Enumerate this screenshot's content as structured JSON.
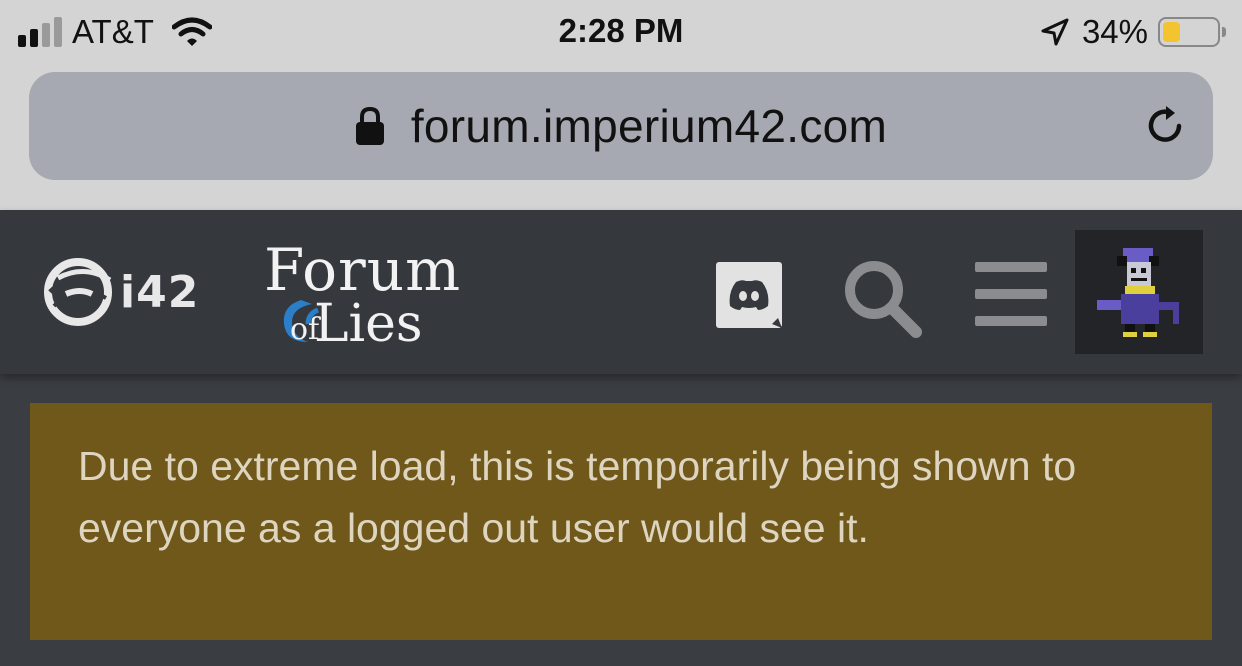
{
  "status_bar": {
    "carrier": "AT&T",
    "time": "2:28 PM",
    "battery_percent": "34%",
    "battery_level": 0.34,
    "signal_bars_active": 2,
    "signal_bars_total": 4,
    "icons": [
      "signal-bars-icon",
      "wifi-icon",
      "location-arrow-icon",
      "battery-icon"
    ]
  },
  "browser": {
    "url": "forum.imperium42.com",
    "icons": [
      "lock-icon",
      "reload-icon"
    ]
  },
  "site_header": {
    "brand_logo_text": "i42",
    "forum_logo": {
      "line1": "Forum",
      "of": "of",
      "line2": "Lies"
    },
    "icons": [
      "discord-icon",
      "search-icon",
      "hamburger-menu-icon",
      "user-avatar"
    ]
  },
  "notice": {
    "text": "Due to extreme load, this is temporarily being shown to everyone as a logged out user would see it."
  },
  "colors": {
    "status_bar_bg": "#d4d4d4",
    "url_bar_bg": "#a6a9b1",
    "header_bg": "#35383d",
    "page_bg": "#3a3d42",
    "notice_bg": "#70581a",
    "notice_text": "#ddd5c0",
    "battery_fill": "#f4c430",
    "logo_accent": "#2a7fc8"
  }
}
